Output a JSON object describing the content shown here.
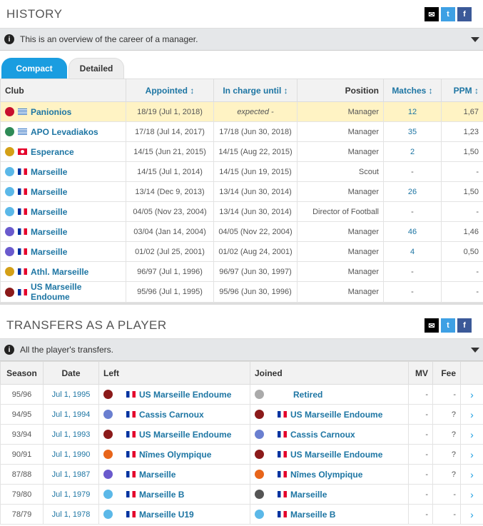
{
  "history": {
    "title": "HISTORY",
    "info": "This is an overview of the career of a manager.",
    "tabs": [
      "Compact",
      "Detailed"
    ],
    "columns": [
      "Club",
      "Appointed ↕",
      "In charge until ↕",
      "Position",
      "Matches ↕",
      "PPM ↕"
    ],
    "rows": [
      {
        "club": "Panionios",
        "crest": "#c8102e",
        "flag": "gr",
        "appointed": "18/19 (Jul 1, 2018)",
        "until": "expected -",
        "position": "Manager",
        "matches": "12",
        "ppm": "1,67",
        "hl": true
      },
      {
        "club": "APO Levadiakos",
        "crest": "#2e8b57",
        "flag": "gr",
        "appointed": "17/18 (Jul 14, 2017)",
        "until": "17/18 (Jun 30, 2018)",
        "position": "Manager",
        "matches": "35",
        "ppm": "1,23"
      },
      {
        "club": "Esperance",
        "crest": "#d4a017",
        "flag": "tn",
        "appointed": "14/15 (Jun 21, 2015)",
        "until": "14/15 (Aug 22, 2015)",
        "position": "Manager",
        "matches": "2",
        "ppm": "1,50"
      },
      {
        "club": "Marseille",
        "crest": "#5bb8e8",
        "flag": "fr",
        "appointed": "14/15 (Jul 1, 2014)",
        "until": "14/15 (Jun 19, 2015)",
        "position": "Scout",
        "matches": "-",
        "ppm": "-"
      },
      {
        "club": "Marseille",
        "crest": "#5bb8e8",
        "flag": "fr",
        "appointed": "13/14 (Dec 9, 2013)",
        "until": "13/14 (Jun 30, 2014)",
        "position": "Manager",
        "matches": "26",
        "ppm": "1,50"
      },
      {
        "club": "Marseille",
        "crest": "#5bb8e8",
        "flag": "fr",
        "appointed": "04/05 (Nov 23, 2004)",
        "until": "13/14 (Jun 30, 2014)",
        "position": "Director of Football",
        "matches": "-",
        "ppm": "-"
      },
      {
        "club": "Marseille",
        "crest": "#6a5acd",
        "flag": "fr",
        "appointed": "03/04 (Jan 14, 2004)",
        "until": "04/05 (Nov 22, 2004)",
        "position": "Manager",
        "matches": "46",
        "ppm": "1,46"
      },
      {
        "club": "Marseille",
        "crest": "#6a5acd",
        "flag": "fr",
        "appointed": "01/02 (Jul 25, 2001)",
        "until": "01/02 (Aug 24, 2001)",
        "position": "Manager",
        "matches": "4",
        "ppm": "0,50"
      },
      {
        "club": "Athl. Marseille",
        "crest": "#d4a017",
        "flag": "fr",
        "appointed": "96/97 (Jul 1, 1996)",
        "until": "96/97 (Jun 30, 1997)",
        "position": "Manager",
        "matches": "-",
        "ppm": "-"
      },
      {
        "club": "US Marseille Endoume",
        "crest": "#8b1a1a",
        "flag": "fr",
        "appointed": "95/96 (Jul 1, 1995)",
        "until": "95/96 (Jun 30, 1996)",
        "position": "Manager",
        "matches": "-",
        "ppm": "-"
      }
    ]
  },
  "transfers": {
    "title": "TRANSFERS AS A PLAYER",
    "info": "All the player's transfers.",
    "columns": [
      "Season",
      "Date",
      "Left",
      "Joined",
      "MV",
      "Fee"
    ],
    "rows": [
      {
        "season": "95/96",
        "date": "Jul 1, 1995",
        "left": "US Marseille Endoume",
        "leftCrest": "#8b1a1a",
        "joined": "Retired",
        "joinedCrest": "#aaaaaa",
        "joinedFlag": false,
        "mv": "-",
        "fee": "-"
      },
      {
        "season": "94/95",
        "date": "Jul 1, 1994",
        "left": "Cassis Carnoux",
        "leftCrest": "#6a7fd0",
        "joined": "US Marseille Endoume",
        "joinedCrest": "#8b1a1a",
        "joinedFlag": true,
        "mv": "-",
        "fee": "?"
      },
      {
        "season": "93/94",
        "date": "Jul 1, 1993",
        "left": "US Marseille Endoume",
        "leftCrest": "#8b1a1a",
        "joined": "Cassis Carnoux",
        "joinedCrest": "#6a7fd0",
        "joinedFlag": true,
        "mv": "-",
        "fee": "?"
      },
      {
        "season": "90/91",
        "date": "Jul 1, 1990",
        "left": "Nîmes Olympique",
        "leftCrest": "#e8651a",
        "joined": "US Marseille Endoume",
        "joinedCrest": "#8b1a1a",
        "joinedFlag": true,
        "mv": "-",
        "fee": "?"
      },
      {
        "season": "87/88",
        "date": "Jul 1, 1987",
        "left": "Marseille",
        "leftCrest": "#6a5acd",
        "joined": "Nîmes Olympique",
        "joinedCrest": "#e8651a",
        "joinedFlag": true,
        "mv": "-",
        "fee": "?"
      },
      {
        "season": "79/80",
        "date": "Jul 1, 1979",
        "left": "Marseille B",
        "leftCrest": "#5bb8e8",
        "joined": "Marseille",
        "joinedCrest": "#555555",
        "joinedFlag": true,
        "mv": "-",
        "fee": "-"
      },
      {
        "season": "78/79",
        "date": "Jul 1, 1978",
        "left": "Marseille U19",
        "leftCrest": "#5bb8e8",
        "joined": "Marseille B",
        "joinedCrest": "#5bb8e8",
        "joinedFlag": true,
        "mv": "-",
        "fee": "-"
      }
    ]
  }
}
